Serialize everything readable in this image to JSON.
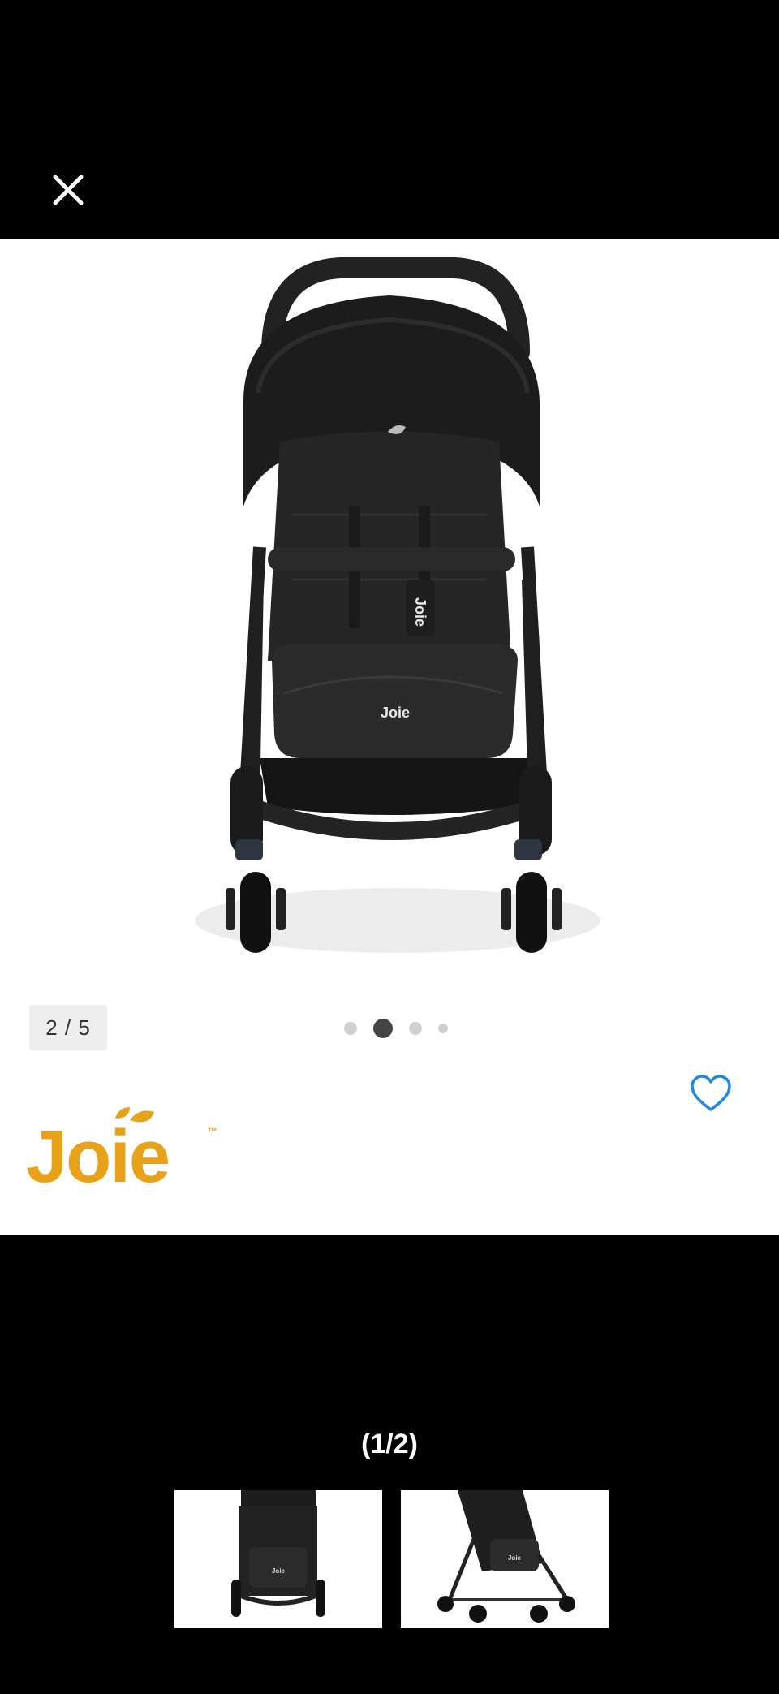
{
  "viewer": {
    "counter": "2 / 5",
    "dots_active_index": 1,
    "dots_count": 4,
    "pager": "(1/2)"
  },
  "brand": {
    "logo_text": "Joie",
    "logo_color": "#E8A21A",
    "seat_logo_text": "Joie"
  },
  "icons": {
    "close": "close-icon",
    "favorite": "heart-outline-icon"
  },
  "colors": {
    "accent_blue": "#1E88E5",
    "background": "#000000",
    "panel": "#FFFFFF"
  },
  "thumbnails": [
    {
      "label": "stroller-front-thumbnail"
    },
    {
      "label": "stroller-side-thumbnail"
    }
  ]
}
